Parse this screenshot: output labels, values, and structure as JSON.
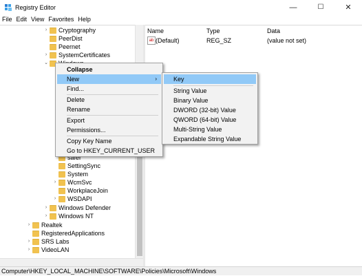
{
  "window": {
    "title": "Registry Editor",
    "minimize": "—",
    "maximize": "☐",
    "close": "✕"
  },
  "menubar": [
    "File",
    "Edit",
    "View",
    "Favorites",
    "Help"
  ],
  "tree": {
    "items": [
      {
        "label": "Cryptography",
        "expander": "›"
      },
      {
        "label": "PeerDist",
        "expander": ""
      },
      {
        "label": "Peernet",
        "expander": ""
      },
      {
        "label": "SystemCertificates",
        "expander": "›"
      },
      {
        "label": "Windows",
        "expander": "⌄"
      },
      {
        "label": "safer",
        "expander": ""
      },
      {
        "label": "SettingSync",
        "expander": ""
      },
      {
        "label": "System",
        "expander": ""
      },
      {
        "label": "WcmSvc",
        "expander": "›"
      },
      {
        "label": "WorkplaceJoin",
        "expander": ""
      },
      {
        "label": "WSDAPI",
        "expander": "›"
      },
      {
        "label": "Windows Defender",
        "expander": "›"
      },
      {
        "label": "Windows NT",
        "expander": "›"
      },
      {
        "label": "Realtek",
        "expander": "›"
      },
      {
        "label": "RegisteredApplications",
        "expander": ""
      },
      {
        "label": "SRS Labs",
        "expander": "›"
      },
      {
        "label": "VideoLAN",
        "expander": "›"
      }
    ]
  },
  "list": {
    "columns": [
      "Name",
      "Type",
      "Data"
    ],
    "rows": [
      {
        "name": "(Default)",
        "type": "REG_SZ",
        "data": "(value not set)",
        "icon": "ab"
      }
    ]
  },
  "context_menu": [
    {
      "label": "Collapse",
      "bold": true
    },
    {
      "label": "New",
      "highlighted": true,
      "submenu": true,
      "arrow": "›"
    },
    {
      "label": "Find..."
    },
    {
      "label": "Delete"
    },
    {
      "label": "Rename"
    },
    {
      "label": "Export"
    },
    {
      "label": "Permissions..."
    },
    {
      "label": "Copy Key Name"
    },
    {
      "label": "Go to HKEY_CURRENT_USER"
    }
  ],
  "submenu": [
    {
      "label": "Key",
      "highlighted": true
    },
    {
      "label": "String Value"
    },
    {
      "label": "Binary Value"
    },
    {
      "label": "DWORD (32-bit) Value"
    },
    {
      "label": "QWORD (64-bit) Value"
    },
    {
      "label": "Multi-String Value"
    },
    {
      "label": "Expandable String Value"
    }
  ],
  "statusbar": "Computer\\HKEY_LOCAL_MACHINE\\SOFTWARE\\Policies\\Microsoft\\Windows",
  "colors": {
    "highlight": "#91c9f7",
    "folder": "#f1c250",
    "menu_bg": "#f2f2f2"
  }
}
